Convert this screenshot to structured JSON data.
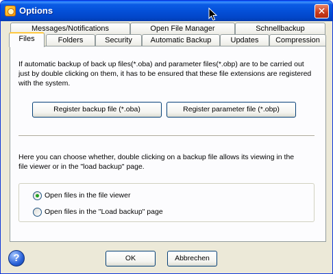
{
  "window": {
    "title": "Options",
    "close_glyph": "✕"
  },
  "tabs": {
    "row_back": [
      {
        "label": "Messages/Notifications"
      },
      {
        "label": "Open File Manager"
      },
      {
        "label": "Schnellbackup"
      }
    ],
    "row_front": [
      {
        "label": "Files",
        "active": true
      },
      {
        "label": "Folders"
      },
      {
        "label": "Security"
      },
      {
        "label": "Automatic Backup"
      },
      {
        "label": "Updates"
      },
      {
        "label": "Compression"
      }
    ]
  },
  "files_tab": {
    "intro_line1": "If automatic backup of back up files(*.oba) and parameter files(*.obp) are to be carried out",
    "intro_line2": "just by double clicking on them, it has to be ensured that these file extensions are registered",
    "intro_line3": "with the system.",
    "register_backup_label": "Register backup file (*.oba)",
    "register_parameter_label": "Register parameter file (*.obp)",
    "choose_line1": "Here you can choose whether, double clicking on a backup file allows its viewing in the",
    "choose_line2": "file viewer or in the \"load backup\" page.",
    "radio_options": [
      {
        "label": "Open files in the file viewer",
        "checked": true
      },
      {
        "label": "Open files in the \"Load backup\" page",
        "checked": false
      }
    ]
  },
  "footer": {
    "help_glyph": "?",
    "ok_label": "OK",
    "cancel_label": "Abbrechen"
  },
  "colors": {
    "titlebar": "#0450d8",
    "window_bg": "#ece9d8",
    "panel_bg": "#fcfcfe",
    "active_tab_accent": "#ffc83c",
    "radio_checked": "#21a121"
  }
}
